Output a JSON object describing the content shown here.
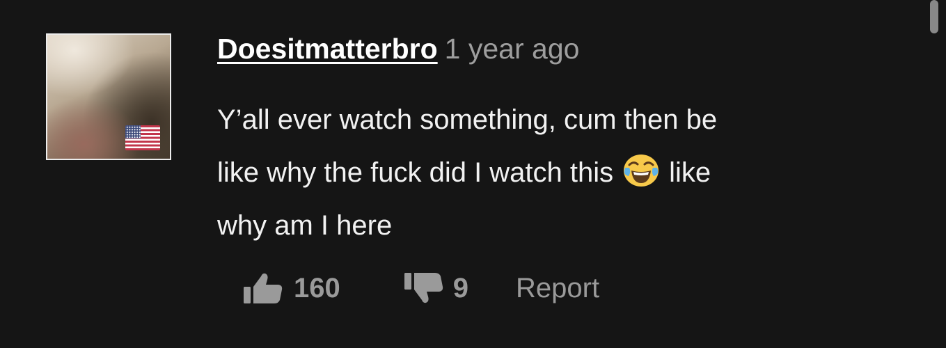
{
  "comment": {
    "username": "Doesitmatterbro",
    "timestamp": "1 year ago",
    "avatar_badge": "us-flag-icon",
    "text_lines": [
      "Y’all ever watch something, cum then be",
      "like why the fuck did I watch this",
      "like",
      "why am I here"
    ],
    "emoji": "face-with-tears-of-joy-icon"
  },
  "actions": {
    "like_icon": "thumbs-up-icon",
    "like_count": "160",
    "dislike_icon": "thumbs-down-icon",
    "dislike_count": "9",
    "report_label": "Report"
  },
  "colors": {
    "background": "#151515",
    "username": "#ffffff",
    "timestamp": "#9e9e9e",
    "body_text": "#f2f2f2",
    "action_gray": "#9a9a9a"
  }
}
